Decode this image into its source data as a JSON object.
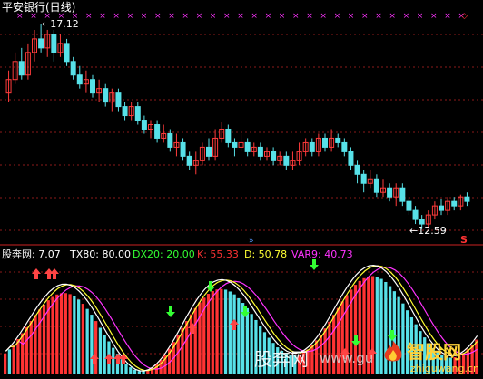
{
  "title": "平安银行(日线)",
  "main_chart": {
    "high_label": "17.12",
    "low_label": "12.59",
    "marker_s": "S",
    "colors": {
      "up": "#ff3b3b",
      "down": "#57e1e8",
      "grid": "#8b1a1a",
      "magenta": "#ff33ff"
    },
    "candles": [
      {
        "o": 15.6,
        "c": 15.9,
        "h": 16.1,
        "l": 15.4
      },
      {
        "o": 15.9,
        "c": 16.3,
        "h": 16.5,
        "l": 15.8
      },
      {
        "o": 16.3,
        "c": 16.0,
        "h": 16.6,
        "l": 15.9
      },
      {
        "o": 16.0,
        "c": 16.5,
        "h": 16.7,
        "l": 15.9
      },
      {
        "o": 16.5,
        "c": 16.8,
        "h": 17.0,
        "l": 16.3
      },
      {
        "o": 16.8,
        "c": 16.6,
        "h": 17.12,
        "l": 16.5
      },
      {
        "o": 16.6,
        "c": 16.9,
        "h": 17.0,
        "l": 16.4
      },
      {
        "o": 16.9,
        "c": 16.5,
        "h": 17.0,
        "l": 16.3
      },
      {
        "o": 16.5,
        "c": 16.7,
        "h": 16.9,
        "l": 16.4
      },
      {
        "o": 16.7,
        "c": 16.3,
        "h": 16.8,
        "l": 16.2
      },
      {
        "o": 16.3,
        "c": 16.0,
        "h": 16.4,
        "l": 15.9
      },
      {
        "o": 16.0,
        "c": 15.8,
        "h": 16.2,
        "l": 15.7
      },
      {
        "o": 15.8,
        "c": 15.9,
        "h": 16.1,
        "l": 15.6
      },
      {
        "o": 15.9,
        "c": 15.6,
        "h": 16.0,
        "l": 15.5
      },
      {
        "o": 15.6,
        "c": 15.7,
        "h": 15.9,
        "l": 15.4
      },
      {
        "o": 15.7,
        "c": 15.4,
        "h": 15.8,
        "l": 15.3
      },
      {
        "o": 15.4,
        "c": 15.6,
        "h": 15.7,
        "l": 15.2
      },
      {
        "o": 15.6,
        "c": 15.3,
        "h": 15.7,
        "l": 15.2
      },
      {
        "o": 15.3,
        "c": 15.1,
        "h": 15.4,
        "l": 15.0
      },
      {
        "o": 15.1,
        "c": 15.3,
        "h": 15.4,
        "l": 15.0
      },
      {
        "o": 15.3,
        "c": 15.0,
        "h": 15.4,
        "l": 14.9
      },
      {
        "o": 15.0,
        "c": 14.8,
        "h": 15.1,
        "l": 14.7
      },
      {
        "o": 14.8,
        "c": 14.9,
        "h": 15.0,
        "l": 14.6
      },
      {
        "o": 14.9,
        "c": 14.6,
        "h": 15.0,
        "l": 14.5
      },
      {
        "o": 14.6,
        "c": 14.7,
        "h": 14.9,
        "l": 14.5
      },
      {
        "o": 14.7,
        "c": 14.4,
        "h": 14.8,
        "l": 14.3
      },
      {
        "o": 14.4,
        "c": 14.5,
        "h": 14.7,
        "l": 14.2
      },
      {
        "o": 14.5,
        "c": 14.2,
        "h": 14.6,
        "l": 14.1
      },
      {
        "o": 14.2,
        "c": 14.0,
        "h": 14.3,
        "l": 13.9
      },
      {
        "o": 14.0,
        "c": 14.1,
        "h": 14.3,
        "l": 13.8
      },
      {
        "o": 14.1,
        "c": 14.4,
        "h": 14.5,
        "l": 14.0
      },
      {
        "o": 14.4,
        "c": 14.2,
        "h": 14.6,
        "l": 14.1
      },
      {
        "o": 14.2,
        "c": 14.6,
        "h": 14.8,
        "l": 14.1
      },
      {
        "o": 14.6,
        "c": 14.8,
        "h": 14.95,
        "l": 14.5
      },
      {
        "o": 14.8,
        "c": 14.5,
        "h": 14.9,
        "l": 14.4
      },
      {
        "o": 14.5,
        "c": 14.4,
        "h": 14.6,
        "l": 14.2
      },
      {
        "o": 14.4,
        "c": 14.5,
        "h": 14.7,
        "l": 14.3
      },
      {
        "o": 14.5,
        "c": 14.3,
        "h": 14.6,
        "l": 14.2
      },
      {
        "o": 14.3,
        "c": 14.4,
        "h": 14.5,
        "l": 14.2
      },
      {
        "o": 14.4,
        "c": 14.2,
        "h": 14.5,
        "l": 14.1
      },
      {
        "o": 14.2,
        "c": 14.3,
        "h": 14.4,
        "l": 14.1
      },
      {
        "o": 14.3,
        "c": 14.1,
        "h": 14.4,
        "l": 14.0
      },
      {
        "o": 14.1,
        "c": 14.2,
        "h": 14.3,
        "l": 14.0
      },
      {
        "o": 14.2,
        "c": 14.0,
        "h": 14.3,
        "l": 13.9
      },
      {
        "o": 14.0,
        "c": 14.1,
        "h": 14.3,
        "l": 13.9
      },
      {
        "o": 14.1,
        "c": 14.3,
        "h": 14.5,
        "l": 14.0
      },
      {
        "o": 14.3,
        "c": 14.5,
        "h": 14.6,
        "l": 14.2
      },
      {
        "o": 14.5,
        "c": 14.3,
        "h": 14.6,
        "l": 14.2
      },
      {
        "o": 14.3,
        "c": 14.6,
        "h": 14.7,
        "l": 14.2
      },
      {
        "o": 14.6,
        "c": 14.4,
        "h": 14.7,
        "l": 14.3
      },
      {
        "o": 14.4,
        "c": 14.6,
        "h": 14.8,
        "l": 14.3
      },
      {
        "o": 14.6,
        "c": 14.5,
        "h": 14.7,
        "l": 14.4
      },
      {
        "o": 14.5,
        "c": 14.3,
        "h": 14.6,
        "l": 14.2
      },
      {
        "o": 14.3,
        "c": 14.0,
        "h": 14.4,
        "l": 13.9
      },
      {
        "o": 14.0,
        "c": 13.8,
        "h": 14.1,
        "l": 13.6
      },
      {
        "o": 13.8,
        "c": 13.6,
        "h": 13.9,
        "l": 13.4
      },
      {
        "o": 13.6,
        "c": 13.7,
        "h": 13.9,
        "l": 13.5
      },
      {
        "o": 13.7,
        "c": 13.4,
        "h": 13.8,
        "l": 13.3
      },
      {
        "o": 13.4,
        "c": 13.5,
        "h": 13.7,
        "l": 13.3
      },
      {
        "o": 13.5,
        "c": 13.3,
        "h": 13.6,
        "l": 13.2
      },
      {
        "o": 13.3,
        "c": 13.5,
        "h": 13.6,
        "l": 13.1
      },
      {
        "o": 13.5,
        "c": 13.2,
        "h": 13.6,
        "l": 13.1
      },
      {
        "o": 13.2,
        "c": 13.0,
        "h": 13.3,
        "l": 12.9
      },
      {
        "o": 13.0,
        "c": 12.8,
        "h": 13.1,
        "l": 12.7
      },
      {
        "o": 12.8,
        "c": 12.7,
        "h": 12.9,
        "l": 12.59
      },
      {
        "o": 12.7,
        "c": 12.9,
        "h": 13.0,
        "l": 12.6
      },
      {
        "o": 12.9,
        "c": 13.1,
        "h": 13.2,
        "l": 12.8
      },
      {
        "o": 13.1,
        "c": 13.0,
        "h": 13.25,
        "l": 12.9
      },
      {
        "o": 13.0,
        "c": 13.2,
        "h": 13.3,
        "l": 12.9
      },
      {
        "o": 13.2,
        "c": 13.1,
        "h": 13.3,
        "l": 13.0
      },
      {
        "o": 13.1,
        "c": 13.3,
        "h": 13.35,
        "l": 13.0
      },
      {
        "o": 13.3,
        "c": 13.2,
        "h": 13.4,
        "l": 13.1
      }
    ]
  },
  "indicator": {
    "name": "股奔网",
    "value": ": 7.07",
    "tx80": "TX80: 80.00",
    "dx20": "DX20: 20.00",
    "k": "K: 55.33",
    "d": "D: 50.78",
    "var9": "VAR9: 40.73",
    "colors": {
      "name": "#ffffff",
      "tx80": "#ffffff",
      "dx20": "#33ff33",
      "k": "#ff3333",
      "d": "#ffff33",
      "var9": "#ff33ff"
    }
  },
  "watermarks": {
    "site_cn": "股奔网",
    "site_url": "www.gu",
    "brand_cn": "智股网",
    "brand_url": "zhiguwang.cn"
  }
}
